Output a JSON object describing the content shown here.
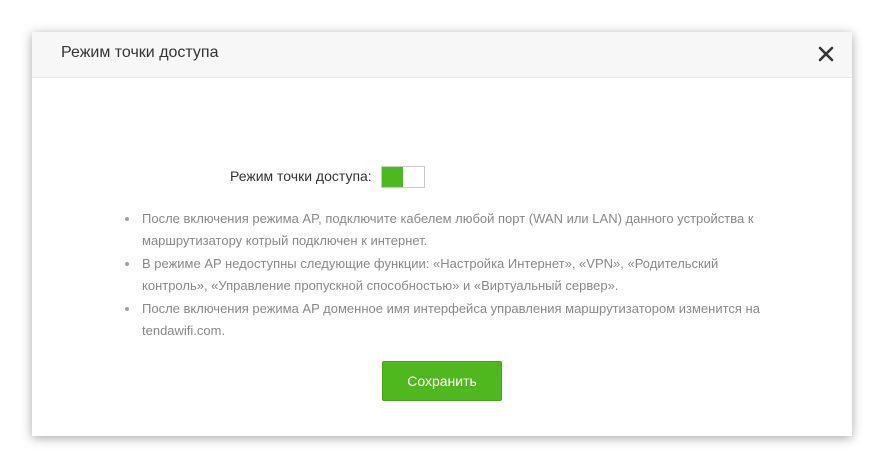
{
  "modal": {
    "title": "Режим точки доступа",
    "close_icon": "close-icon"
  },
  "ap_mode": {
    "label": "Режим точки доступа:",
    "enabled": true,
    "on_color": "#4fb81f"
  },
  "notes": [
    "После включения режима AP, подключите кабелем любой порт (WAN или LAN) данного устройства к маршрутизатору котрый подключен к интернет.",
    "В режиме AP недоступны следующие функции: «Настройка Интернет», «VPN», «Родительский контроль», «Управление пропускной способностью» и «Виртуальный сервер».",
    "После включения режима AP доменное имя интерфейса управления маршрутизатором изменится на tendawifi.com."
  ],
  "actions": {
    "save_label": "Сохранить",
    "button_color": "#4fb81f"
  }
}
